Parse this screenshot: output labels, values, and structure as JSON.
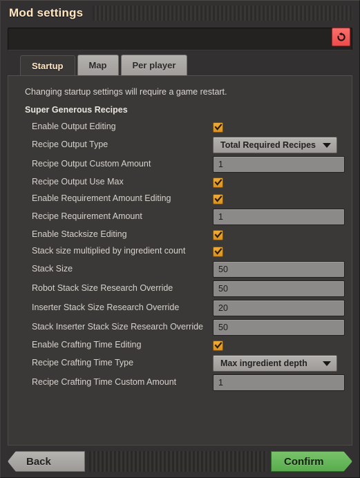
{
  "window": {
    "title": "Mod settings"
  },
  "search": {
    "value": "",
    "placeholder": "",
    "reset_icon": "reset-arrow-icon",
    "reset_color": "#ef4b4b"
  },
  "tabs": [
    {
      "label": "Startup",
      "active": true
    },
    {
      "label": "Map",
      "active": false
    },
    {
      "label": "Per player",
      "active": false
    }
  ],
  "content": {
    "restart_note": "Changing startup settings will require a game restart.",
    "group_title": "Super Generous Recipes",
    "settings": [
      {
        "label": "Enable Output Editing",
        "type": "checkbox",
        "checked": true
      },
      {
        "label": "Recipe Output Type",
        "type": "dropdown",
        "value": "Total Required Recipes"
      },
      {
        "label": "Recipe Output Custom Amount",
        "type": "number",
        "value": "1"
      },
      {
        "label": "Recipe Output Use Max",
        "type": "checkbox",
        "checked": true
      },
      {
        "label": "Enable Requirement Amount Editing",
        "type": "checkbox",
        "checked": true
      },
      {
        "label": "Recipe Requirement Amount",
        "type": "number",
        "value": "1"
      },
      {
        "label": "Enable Stacksize Editing",
        "type": "checkbox",
        "checked": true
      },
      {
        "label": "Stack size multiplied by ingredient count",
        "type": "checkbox",
        "checked": true
      },
      {
        "label": "Stack Size",
        "type": "number",
        "value": "50"
      },
      {
        "label": "Robot Stack Size Research Override",
        "type": "number",
        "value": "50"
      },
      {
        "label": "Inserter Stack Size Research Override",
        "type": "number",
        "value": "20"
      },
      {
        "label": "Stack Inserter Stack Size Research Override",
        "type": "number",
        "value": "50"
      },
      {
        "label": "Enable Crafting Time Editing",
        "type": "checkbox",
        "checked": true
      },
      {
        "label": "Recipe Crafting Time Type",
        "type": "dropdown",
        "value": "Max ingredient depth"
      },
      {
        "label": "Recipe Crafting Time Custom Amount",
        "type": "number",
        "value": "1"
      }
    ]
  },
  "footer": {
    "back_label": "Back",
    "confirm_label": "Confirm",
    "confirm_color": "#58ab4d"
  }
}
